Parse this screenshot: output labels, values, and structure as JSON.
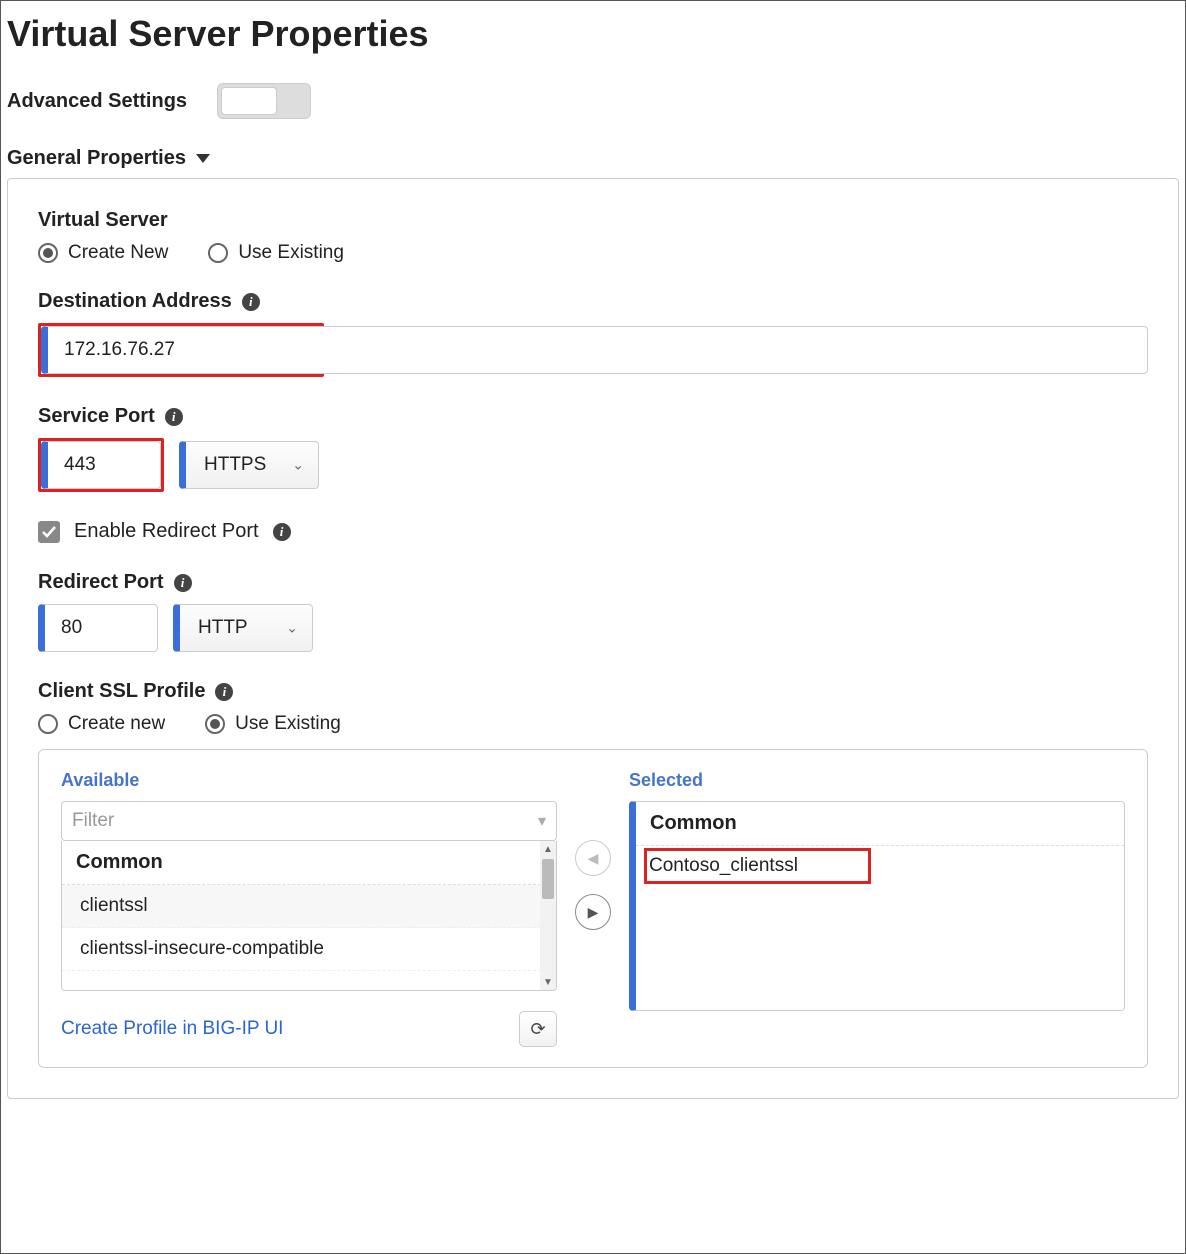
{
  "title": "Virtual Server Properties",
  "advanced": {
    "label": "Advanced Settings",
    "on": false
  },
  "section": {
    "header": "General Properties"
  },
  "virtual_server": {
    "label": "Virtual Server",
    "options": {
      "create": "Create New",
      "existing": "Use Existing"
    },
    "selected": "create"
  },
  "dest_addr": {
    "label": "Destination Address",
    "value": "172.16.76.27"
  },
  "service_port": {
    "label": "Service Port",
    "value": "443",
    "protocol": "HTTPS"
  },
  "redirect_enable": {
    "label": "Enable Redirect Port",
    "checked": true
  },
  "redirect_port": {
    "label": "Redirect Port",
    "value": "80",
    "protocol": "HTTP"
  },
  "ssl": {
    "label": "Client SSL Profile",
    "options": {
      "create": "Create new",
      "existing": "Use Existing"
    },
    "selected": "existing",
    "available": {
      "title": "Available",
      "filter_placeholder": "Filter",
      "group": "Common",
      "items": [
        "clientssl",
        "clientssl-insecure-compatible"
      ]
    },
    "selected_list": {
      "title": "Selected",
      "group": "Common",
      "items": [
        "Contoso_clientssl"
      ]
    },
    "create_link": "Create Profile in BIG-IP UI"
  }
}
